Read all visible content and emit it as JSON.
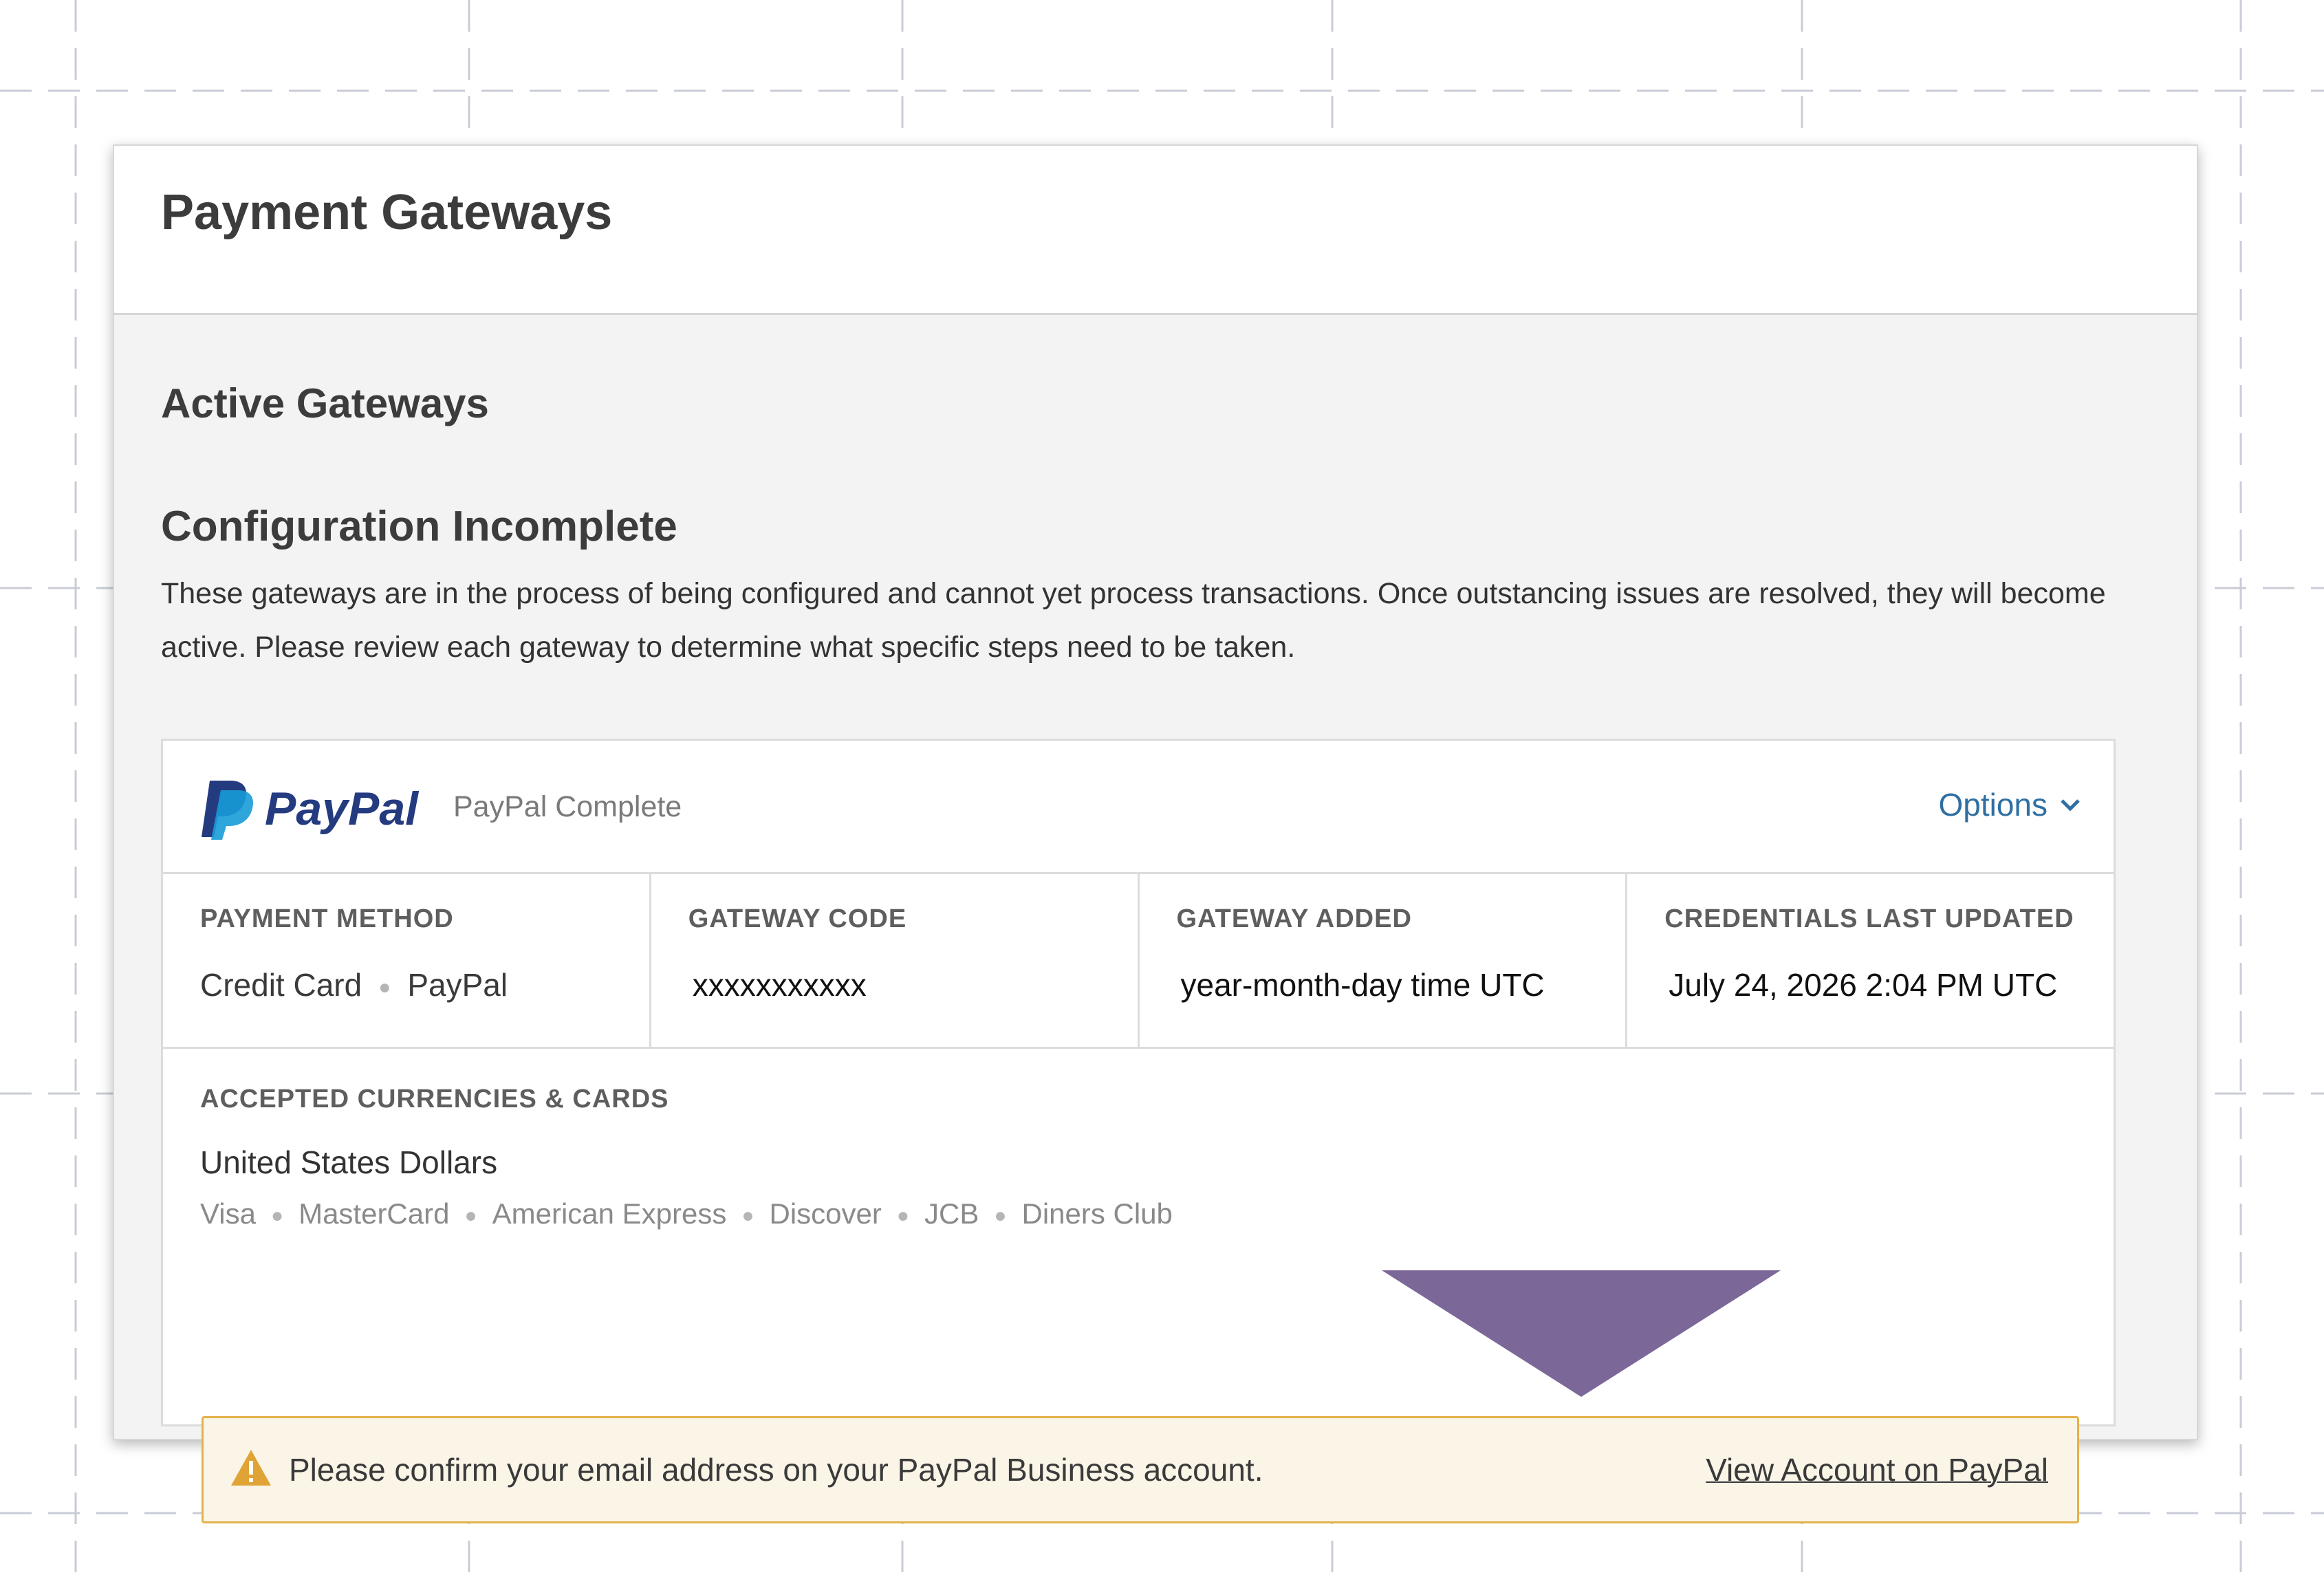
{
  "page": {
    "title": "Payment Gateways"
  },
  "section": {
    "title": "Active Gateways"
  },
  "group": {
    "title": "Configuration Incomplete",
    "description": "These gateways are in the process of being configured and cannot yet process transactions. Once outstancing issues are resolved, they will become active. Please review each gateway to determine what specific steps need to be taken."
  },
  "gateway": {
    "logo_text": "PayPal",
    "name": "PayPal Complete",
    "options_label": "Options",
    "info": [
      {
        "label": "PAYMENT METHOD",
        "values": [
          "Credit Card",
          "PayPal"
        ]
      },
      {
        "label": "GATEWAY CODE",
        "value": "xxxxxxxxxxx"
      },
      {
        "label": "GATEWAY ADDED",
        "value": "year-month-day time UTC"
      },
      {
        "label": "CREDENTIALS LAST UPDATED",
        "value": "July 24, 2026 2:04 PM UTC"
      }
    ],
    "currencies": {
      "label": "ACCEPTED CURRENCIES & CARDS",
      "currency": "United States Dollars",
      "cards": [
        "Visa",
        "MasterCard",
        "American Express",
        "Discover",
        "JCB",
        "Diners Club"
      ]
    },
    "alert": {
      "message": "Please confirm your email address on your PayPal Business account.",
      "link": "View Account on PayPal"
    }
  },
  "colors": {
    "accent_link": "#2f6fa3",
    "warning_border": "#e4b24a",
    "warning_bg": "#fbf5e8",
    "arrow": "#7b6899",
    "paypal_dark": "#253b80",
    "paypal_light": "#179bd7"
  },
  "icons": [
    "paypal-logo-icon",
    "chevron-down-icon",
    "warning-icon",
    "arrow-down-icon"
  ]
}
